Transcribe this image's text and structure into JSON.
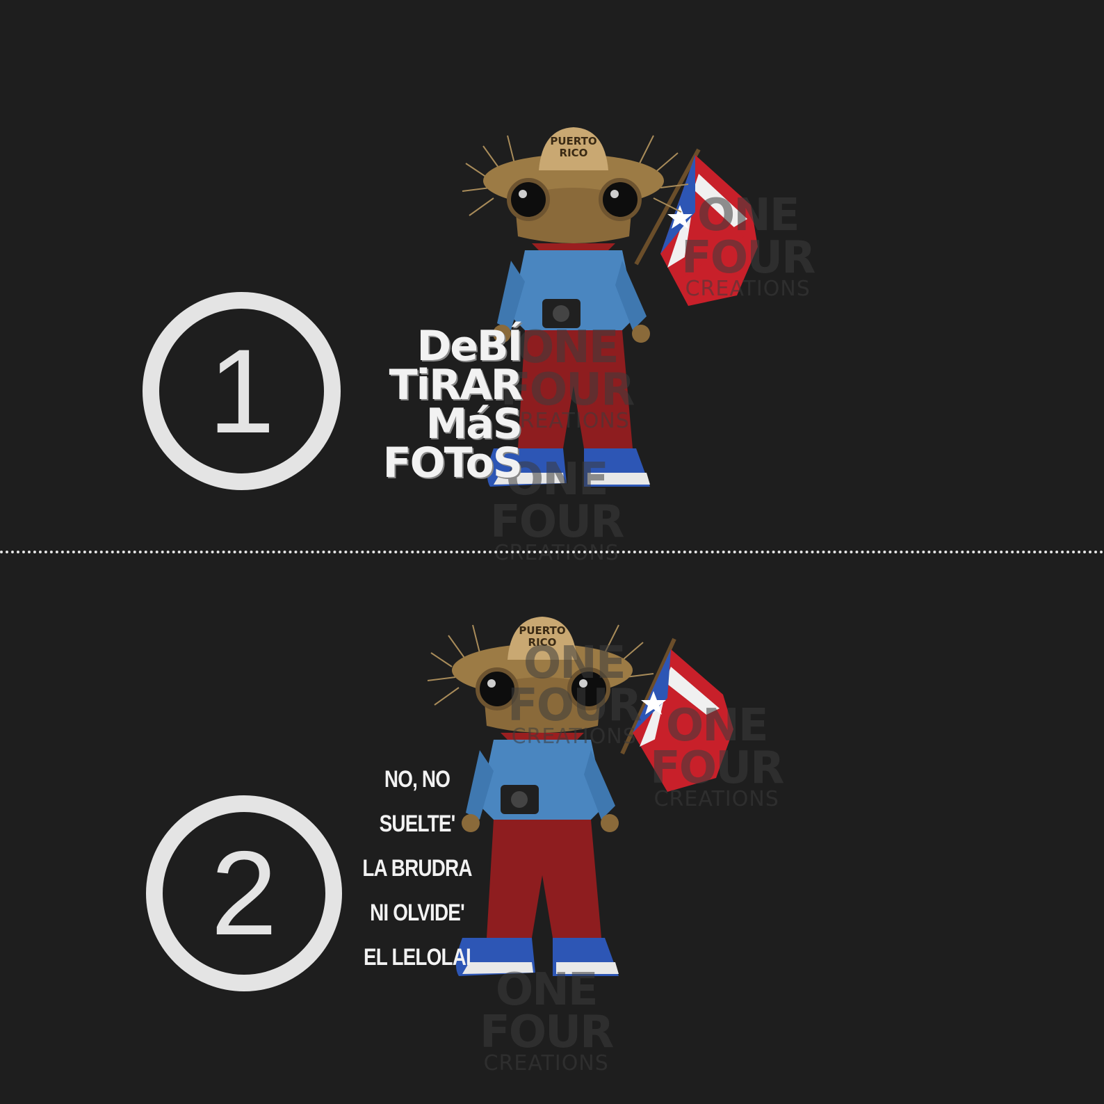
{
  "colors": {
    "background": "#1e1e1e",
    "circle_and_text": "#e4e4e4",
    "divider": "#e6e6e6",
    "flag_red": "#c8202a",
    "flag_blue": "#2d56b5",
    "denim": "#4a86c0",
    "pants": "#8e1d1f",
    "straw": "#a07a40"
  },
  "panels": [
    {
      "number": "1",
      "caption_lines": [
        "DeBÍ",
        "TiRAR",
        "MáS",
        "FOToS"
      ],
      "hat_text": [
        "PUERTO",
        "RICO"
      ]
    },
    {
      "number": "2",
      "caption_lines": [
        "NO, NO",
        "SUELTE'",
        "LA BRUDRA",
        "NI OLVIDE'",
        "EL LELOLAI"
      ],
      "hat_text": [
        "PUERTO",
        "RICO"
      ]
    }
  ],
  "watermark": {
    "line1": "ONE",
    "line2": "FOUR",
    "line3": "CREATIONS"
  }
}
